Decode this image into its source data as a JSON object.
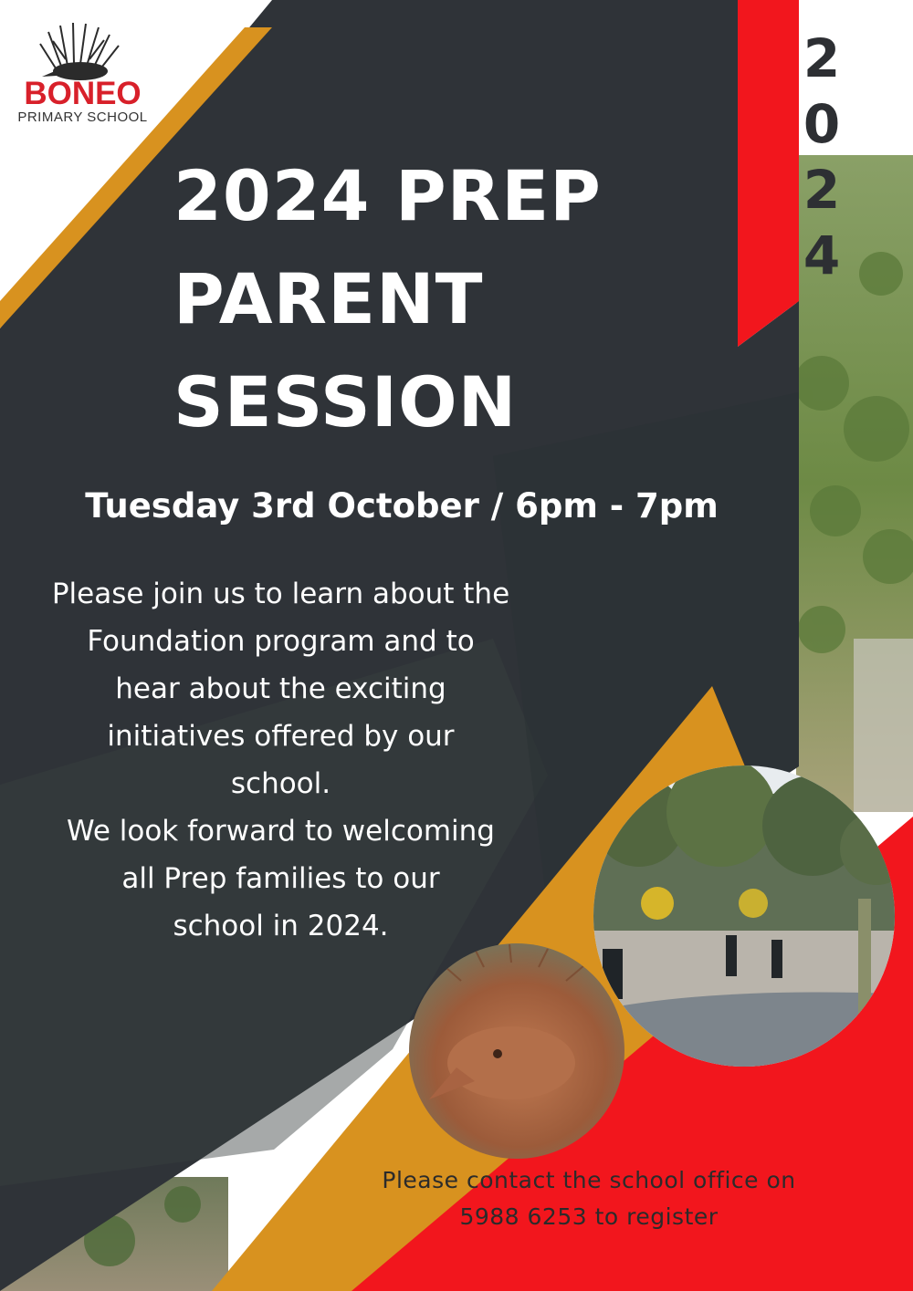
{
  "logo": {
    "name": "BONEO",
    "subtitle": "PRIMARY SCHOOL"
  },
  "ribbon_year_digits": [
    "2",
    "0",
    "2",
    "4"
  ],
  "title_lines": [
    "2024 PREP",
    "PARENT",
    "SESSION"
  ],
  "date_line": "Tuesday 3rd October / 6pm - 7pm",
  "body_lines": [
    "Please join us to learn about the",
    "Foundation program and to",
    "hear about the exciting",
    "initiatives offered by our",
    "school.",
    "We look forward to welcoming",
    "all Prep families to our",
    "school in 2024."
  ],
  "contact_lines": [
    "Please contact the school office on",
    "5988 6253 to register"
  ],
  "colors": {
    "dark_panel": "#2f3338",
    "accent_gold": "#d8921f",
    "accent_red": "#f2161d",
    "text_white": "#ffffff",
    "ribbon_text": "#2d2f33",
    "logo_red": "#d8202a"
  },
  "photos": [
    "school-courtyard-photo",
    "echidna-sculpture-photo"
  ]
}
